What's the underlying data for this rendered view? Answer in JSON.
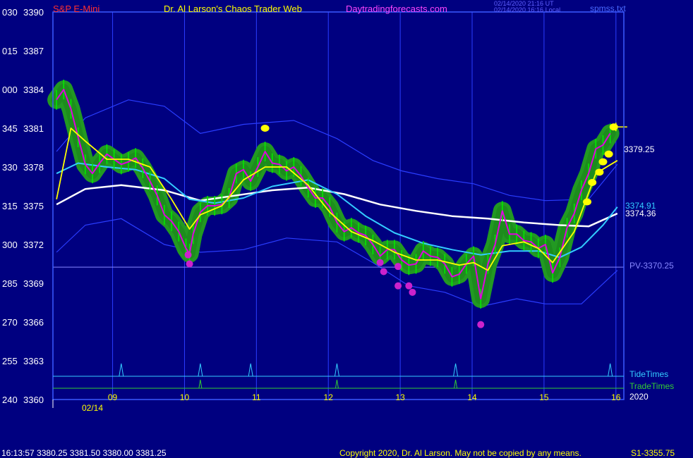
{
  "header": {
    "symbol": "S&P E-Mini",
    "title": "Dr. Al Larson's Chaos Trader Web",
    "site": "Daytradingforecasts.com",
    "utc_time": "02/14/2020 21:16 UT",
    "local_time": "02/14/2020 16:16 Local",
    "file": "spmss.txt"
  },
  "footer": {
    "quote": "16:13:57  3380.25  3381.50  3380.00  3381.25",
    "copyright": "Copyright 2020, Dr. Al Larson. May not be copied by any means.",
    "s1": "S1-3355.75"
  },
  "labels": {
    "tide_times": "TideTimes",
    "trade_times": "TradeTimes",
    "year": "2020",
    "date": "02/14",
    "price_last": "3379.25",
    "ma_fast": "3374.91",
    "ma_slow": "3374.36",
    "pivot": "PV-3370.25"
  },
  "colors": {
    "background": "#000080",
    "frame": "#3b5bff",
    "price": "#00ee00",
    "green_halo": "#229922",
    "magenta": "#e000e0",
    "yellow": "#ffff00",
    "cyan": "#33ccff",
    "white": "#ffffff",
    "band": "#2a3dff",
    "pivot_line": "#8888ff",
    "tide": "#33ccff",
    "trade": "#33cc33"
  },
  "chart_data": {
    "type": "line",
    "title": "S&P E-Mini",
    "ylim": [
      3360,
      3390
    ],
    "y_ticks": [
      {
        "left": "030",
        "value": 3390
      },
      {
        "left": "015",
        "value": 3387
      },
      {
        "left": "000",
        "value": 3384
      },
      {
        "left": "345",
        "value": 3381
      },
      {
        "left": "330",
        "value": 3378
      },
      {
        "left": "315",
        "value": 3375
      },
      {
        "left": "300",
        "value": 3372
      },
      {
        "left": "285",
        "value": 3369
      },
      {
        "left": "270",
        "value": 3366
      },
      {
        "left": "255",
        "value": 3363
      },
      {
        "left": "240",
        "value": 3360
      }
    ],
    "x_hours": [
      "09",
      "10",
      "11",
      "12",
      "13",
      "14",
      "15",
      "16"
    ],
    "pivot": 3370.25,
    "price": [
      [
        8.3,
        3383.2
      ],
      [
        8.4,
        3384.0
      ],
      [
        8.5,
        3382.5
      ],
      [
        8.6,
        3380.3
      ],
      [
        8.7,
        3378.2
      ],
      [
        8.8,
        3377.5
      ],
      [
        8.9,
        3378.3
      ],
      [
        9.0,
        3379.0
      ],
      [
        9.1,
        3378.6
      ],
      [
        9.2,
        3378.2
      ],
      [
        9.3,
        3378.4
      ],
      [
        9.4,
        3378.7
      ],
      [
        9.5,
        3377.9
      ],
      [
        9.6,
        3376.9
      ],
      [
        9.7,
        3375.8
      ],
      [
        9.8,
        3374.3
      ],
      [
        9.9,
        3373.8
      ],
      [
        10.0,
        3373.0
      ],
      [
        10.1,
        3371.7
      ],
      [
        10.15,
        3371.3
      ],
      [
        10.2,
        3372.8
      ],
      [
        10.3,
        3374.5
      ],
      [
        10.4,
        3375.0
      ],
      [
        10.5,
        3375.0
      ],
      [
        10.6,
        3375.1
      ],
      [
        10.7,
        3375.6
      ],
      [
        10.8,
        3377.5
      ],
      [
        10.9,
        3377.8
      ],
      [
        11.0,
        3376.9
      ],
      [
        11.1,
        3378.0
      ],
      [
        11.2,
        3379.2
      ],
      [
        11.3,
        3378.3
      ],
      [
        11.4,
        3378.2
      ],
      [
        11.5,
        3377.7
      ],
      [
        11.6,
        3378.0
      ],
      [
        11.7,
        3377.3
      ],
      [
        11.8,
        3376.4
      ],
      [
        11.9,
        3375.6
      ],
      [
        12.0,
        3375.6
      ],
      [
        12.1,
        3374.9
      ],
      [
        12.2,
        3373.7
      ],
      [
        12.3,
        3373.0
      ],
      [
        12.4,
        3373.3
      ],
      [
        12.5,
        3372.9
      ],
      [
        12.6,
        3372.7
      ],
      [
        12.7,
        3372.0
      ],
      [
        12.8,
        3371.1
      ],
      [
        12.9,
        3371.6
      ],
      [
        13.0,
        3371.6
      ],
      [
        13.1,
        3370.8
      ],
      [
        13.2,
        3370.4
      ],
      [
        13.3,
        3370.5
      ],
      [
        13.4,
        3371.5
      ],
      [
        13.5,
        3371.1
      ],
      [
        13.6,
        3371.0
      ],
      [
        13.7,
        3370.5
      ],
      [
        13.8,
        3369.5
      ],
      [
        13.9,
        3369.7
      ],
      [
        14.0,
        3370.5
      ],
      [
        14.1,
        3371.1
      ],
      [
        14.2,
        3367.8
      ],
      [
        14.3,
        3370.5
      ],
      [
        14.4,
        3372.0
      ],
      [
        14.5,
        3374.6
      ],
      [
        14.6,
        3372.8
      ],
      [
        14.7,
        3372.8
      ],
      [
        14.8,
        3372.3
      ],
      [
        14.9,
        3372.2
      ],
      [
        15.0,
        3371.7
      ],
      [
        15.1,
        3372.0
      ],
      [
        15.2,
        3369.8
      ],
      [
        15.3,
        3371.0
      ],
      [
        15.4,
        3373.3
      ],
      [
        15.5,
        3374.4
      ],
      [
        15.6,
        3376.2
      ],
      [
        15.7,
        3377.5
      ],
      [
        15.8,
        3379.4
      ],
      [
        15.9,
        3379.7
      ],
      [
        16.0,
        3380.6
      ]
    ],
    "ma_yellow": [
      [
        8.3,
        3375.5
      ],
      [
        8.5,
        3381.0
      ],
      [
        8.7,
        3380.0
      ],
      [
        9.0,
        3378.6
      ],
      [
        9.3,
        3378.6
      ],
      [
        9.6,
        3378.0
      ],
      [
        9.9,
        3375.5
      ],
      [
        10.15,
        3373.2
      ],
      [
        10.3,
        3374.3
      ],
      [
        10.6,
        3375.0
      ],
      [
        10.9,
        3377.0
      ],
      [
        11.2,
        3378.0
      ],
      [
        11.5,
        3378.0
      ],
      [
        11.8,
        3376.6
      ],
      [
        12.1,
        3374.5
      ],
      [
        12.4,
        3373.0
      ],
      [
        12.7,
        3372.3
      ],
      [
        13.0,
        3371.4
      ],
      [
        13.3,
        3370.8
      ],
      [
        13.6,
        3370.8
      ],
      [
        13.9,
        3370.4
      ],
      [
        14.1,
        3370.6
      ],
      [
        14.3,
        3370.0
      ],
      [
        14.5,
        3371.9
      ],
      [
        14.8,
        3372.2
      ],
      [
        15.0,
        3371.7
      ],
      [
        15.2,
        3370.6
      ],
      [
        15.5,
        3373.0
      ],
      [
        15.8,
        3377.5
      ],
      [
        16.1,
        3378.5
      ]
    ],
    "ma_cyan": [
      [
        8.3,
        3377.5
      ],
      [
        8.6,
        3378.3
      ],
      [
        9.0,
        3378.0
      ],
      [
        9.4,
        3377.8
      ],
      [
        9.8,
        3377.1
      ],
      [
        10.15,
        3375.5
      ],
      [
        10.5,
        3375.2
      ],
      [
        10.9,
        3375.6
      ],
      [
        11.3,
        3376.5
      ],
      [
        11.8,
        3377.0
      ],
      [
        12.2,
        3375.9
      ],
      [
        12.6,
        3374.2
      ],
      [
        13.0,
        3372.9
      ],
      [
        13.4,
        3372.1
      ],
      [
        13.8,
        3371.6
      ],
      [
        14.2,
        3371.2
      ],
      [
        14.6,
        3371.5
      ],
      [
        15.0,
        3371.5
      ],
      [
        15.3,
        3371.0
      ],
      [
        15.6,
        3371.8
      ],
      [
        15.9,
        3373.5
      ],
      [
        16.1,
        3374.9
      ]
    ],
    "ma_white": [
      [
        8.3,
        3375.1
      ],
      [
        8.7,
        3376.3
      ],
      [
        9.2,
        3376.6
      ],
      [
        9.8,
        3376.2
      ],
      [
        10.3,
        3375.4
      ],
      [
        10.8,
        3375.8
      ],
      [
        11.3,
        3376.2
      ],
      [
        11.8,
        3376.4
      ],
      [
        12.3,
        3375.9
      ],
      [
        12.8,
        3375.1
      ],
      [
        13.3,
        3374.6
      ],
      [
        13.8,
        3374.2
      ],
      [
        14.3,
        3374.0
      ],
      [
        14.8,
        3373.7
      ],
      [
        15.3,
        3373.5
      ],
      [
        15.7,
        3373.4
      ],
      [
        16.1,
        3374.4
      ]
    ],
    "band_upper": [
      [
        8.3,
        3379.2
      ],
      [
        8.7,
        3381.8
      ],
      [
        9.3,
        3383.2
      ],
      [
        9.8,
        3382.7
      ],
      [
        10.3,
        3380.6
      ],
      [
        10.9,
        3381.3
      ],
      [
        11.6,
        3381.6
      ],
      [
        12.2,
        3380.2
      ],
      [
        12.7,
        3378.5
      ],
      [
        13.1,
        3377.7
      ],
      [
        13.6,
        3377.1
      ],
      [
        14.1,
        3376.7
      ],
      [
        14.6,
        3375.8
      ],
      [
        15.1,
        3375.4
      ],
      [
        15.7,
        3375.5
      ],
      [
        16.1,
        3378.2
      ]
    ],
    "band_lower": [
      [
        8.3,
        3371.4
      ],
      [
        8.7,
        3373.5
      ],
      [
        9.2,
        3374.0
      ],
      [
        9.8,
        3372.0
      ],
      [
        10.3,
        3371.4
      ],
      [
        10.9,
        3371.6
      ],
      [
        11.5,
        3372.5
      ],
      [
        12.2,
        3372.2
      ],
      [
        12.7,
        3370.6
      ],
      [
        13.2,
        3368.8
      ],
      [
        13.7,
        3368.3
      ],
      [
        14.2,
        3367.2
      ],
      [
        14.7,
        3367.8
      ],
      [
        15.1,
        3367.4
      ],
      [
        15.6,
        3367.4
      ],
      [
        16.1,
        3370.0
      ]
    ],
    "magenta_dots": [
      [
        10.13,
        3371.2
      ],
      [
        10.15,
        3370.5
      ],
      [
        12.8,
        3370.6
      ],
      [
        12.85,
        3369.9
      ],
      [
        13.05,
        3370.3
      ],
      [
        13.05,
        3368.8
      ],
      [
        13.2,
        3368.8
      ],
      [
        13.25,
        3368.3
      ],
      [
        14.2,
        3365.8
      ]
    ],
    "yellow_dots": [
      [
        11.2,
        3381.0
      ],
      [
        15.68,
        3375.3
      ],
      [
        15.75,
        3376.8
      ],
      [
        15.85,
        3377.6
      ],
      [
        15.9,
        3378.4
      ],
      [
        15.98,
        3379.0
      ],
      [
        16.05,
        3381.1
      ]
    ],
    "tide_times": [
      9.2,
      10.3,
      11.0,
      12.2,
      13.85,
      16.0
    ],
    "trade_times": [
      10.3,
      12.2,
      13.85
    ]
  }
}
